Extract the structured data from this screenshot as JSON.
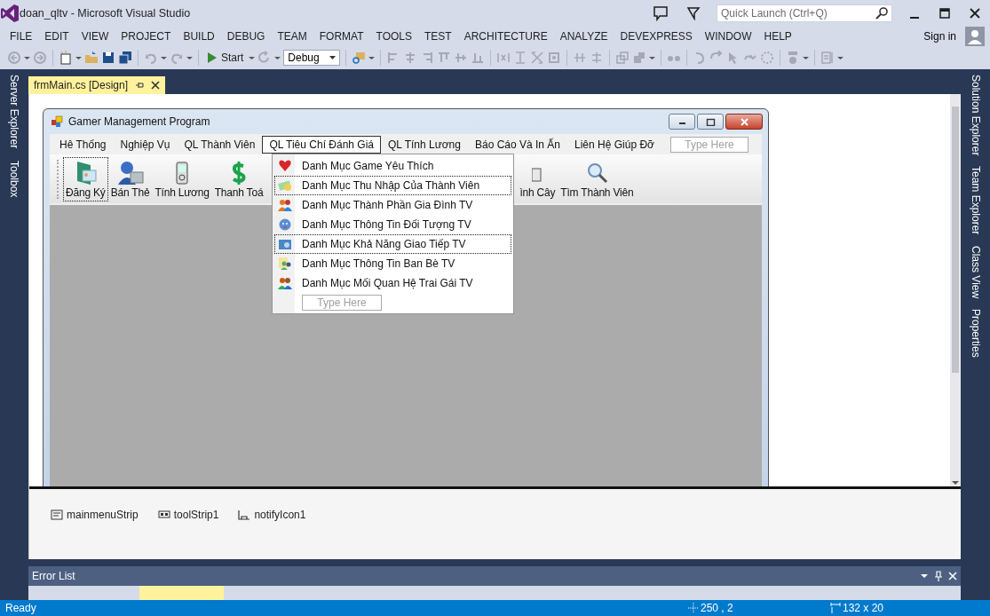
{
  "window": {
    "title": "doan_qltv - Microsoft Visual Studio"
  },
  "quick_launch": {
    "placeholder": "Quick Launch (Ctrl+Q)"
  },
  "menu": [
    "FILE",
    "EDIT",
    "VIEW",
    "PROJECT",
    "BUILD",
    "DEBUG",
    "TEAM",
    "FORMAT",
    "TOOLS",
    "TEST",
    "ARCHITECTURE",
    "ANALYZE",
    "DEVEXPRESS",
    "WINDOW",
    "HELP"
  ],
  "sign_in": "Sign in",
  "toolbar": {
    "start": "Start",
    "configuration": "Debug"
  },
  "left_tabs": [
    "Server Explorer",
    "Toolbox"
  ],
  "right_tabs": [
    "Solution Explorer",
    "Team Explorer",
    "Class View",
    "Properties"
  ],
  "document_tab": {
    "title": "frmMain.cs [Design]"
  },
  "designer": {
    "form_title": "Gamer Management Program",
    "menu": [
      {
        "label": "Hê Thống",
        "selected": false
      },
      {
        "label": "Nghiệp Vụ",
        "selected": false
      },
      {
        "label": "QL Thành Viên",
        "selected": false
      },
      {
        "label": "QL Tiêu Chí Đánh Giá",
        "selected": true
      },
      {
        "label": "QL Tính Lương",
        "selected": false
      },
      {
        "label": "Báo Cáo Và In Ấn",
        "selected": false
      },
      {
        "label": "Liên Hệ Giúp Đỡ",
        "selected": false
      }
    ],
    "menu_placeholder": "Type Here",
    "toolbar": [
      {
        "label": "Đăng Ký",
        "kind": "card",
        "selected": true
      },
      {
        "label": "Bán Thẻ",
        "kind": "person",
        "selected": false
      },
      {
        "label": "Tính Lương",
        "kind": "device",
        "selected": false
      },
      {
        "label": "Thanh Toá",
        "kind": "coin",
        "selected": false
      },
      {
        "label": "ình Cây",
        "kind": "partial",
        "selected": false
      },
      {
        "label": "Tìm Thành Viên",
        "kind": "search",
        "selected": false
      }
    ],
    "dropdown": {
      "items": [
        {
          "label": "Danh Mục Game Yêu Thích",
          "kind": "heart",
          "selected": false
        },
        {
          "label": "Danh Mục Thu Nhập Của Thành Viên",
          "kind": "money",
          "selected": true
        },
        {
          "label": "Danh Mục Thành Phần Gia Đình TV",
          "kind": "group",
          "selected": false
        },
        {
          "label": "Danh Mục Thông Tin Đối Tượng TV",
          "kind": "face",
          "selected": false
        },
        {
          "label": "Danh Mục Khả Năng Giao Tiếp TV",
          "kind": "photo",
          "selected": true
        },
        {
          "label": "Danh Mục Thông Tin Ban Bè TV",
          "kind": "friends",
          "selected": false
        },
        {
          "label": "Danh Mục Mối Quan Hệ Trai Gái TV",
          "kind": "couple",
          "selected": false
        }
      ],
      "placeholder": "Type Here"
    }
  },
  "component_tray": [
    {
      "label": "mainmenuStrip",
      "kind": "menu"
    },
    {
      "label": "toolStrip1",
      "kind": "toolstrip"
    },
    {
      "label": "notifyIcon1",
      "kind": "notify"
    }
  ],
  "error_list": {
    "title": "Error List"
  },
  "status_bar": {
    "text": "Ready",
    "position": "250 , 2",
    "size": "132 x 20"
  }
}
